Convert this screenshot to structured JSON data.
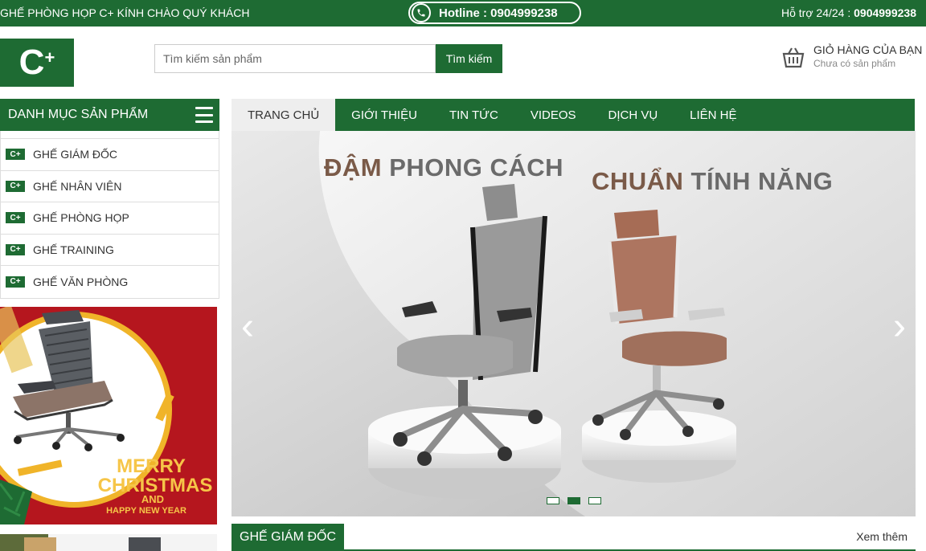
{
  "topbar": {
    "welcome": "GHẾ PHÒNG HỌP C+ KÍNH CHÀO QUÝ KHÁCH",
    "hotline": "Hotline : 0904999238",
    "support_label": "Hỗ trợ 24/24 : ",
    "support_phone": "0904999238"
  },
  "logo": {
    "c": "C",
    "plus": "+"
  },
  "search": {
    "placeholder": "Tìm kiếm sản phẩm",
    "button": "Tìm kiếm"
  },
  "cart": {
    "title": "GIỎ HÀNG CỦA BẠN",
    "status": "Chưa có sản phẩm"
  },
  "categories": {
    "header": "DANH MỤC SẢN PHẨM",
    "items": [
      {
        "label": "GHẾ GIÁM ĐỐC"
      },
      {
        "label": "GHẾ NHÂN VIÊN"
      },
      {
        "label": "GHẾ PHÒNG HỌP"
      },
      {
        "label": "GHẾ TRAINING"
      },
      {
        "label": "GHẾ VĂN PHÒNG"
      }
    ],
    "icon_text": "C+"
  },
  "promo": {
    "line1": "MERRY",
    "line2": "CHRISTMAS",
    "line3": "AND",
    "line4": "HAPPY NEW YEAR"
  },
  "nav": {
    "items": [
      {
        "label": "TRANG CHỦ"
      },
      {
        "label": "GIỚI THIỆU"
      },
      {
        "label": "TIN TỨC"
      },
      {
        "label": "VIDEOS"
      },
      {
        "label": "DỊCH VỤ"
      },
      {
        "label": "LIÊN HỆ"
      }
    ]
  },
  "slider": {
    "headline1_a": "ĐẬM",
    "headline1_b": " PHONG CÁCH",
    "headline2_a": "CHUẨN",
    "headline2_b": " TÍNH NĂNG",
    "prev": "‹",
    "next": "›",
    "active_dot": 2,
    "dot_count": 3
  },
  "section": {
    "title": "GHẾ GIÁM ĐỐC",
    "more": "Xem thêm"
  },
  "colors": {
    "brand": "#1e6b33",
    "accent_red": "#b5161e",
    "gold": "#f0b429"
  }
}
